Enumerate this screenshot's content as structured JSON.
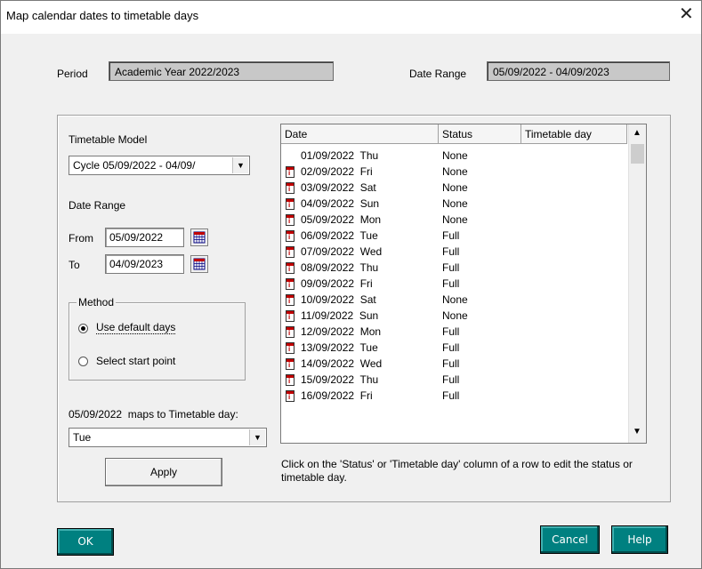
{
  "window": {
    "title": "Map calendar dates to timetable days",
    "close_glyph": "✕"
  },
  "period": {
    "label": "Period",
    "value": "Academic Year 2022/2023"
  },
  "date_range_top": {
    "label": "Date Range",
    "value": "05/09/2022 - 04/09/2023"
  },
  "timetable_model": {
    "label": "Timetable Model",
    "value": "Cycle 05/09/2022 - 04/09/"
  },
  "date_range": {
    "label": "Date Range",
    "from_label": "From",
    "from_value": "05/09/2022",
    "to_label": "To",
    "to_value": "04/09/2023"
  },
  "method": {
    "label": "Method",
    "options": [
      {
        "label": "Use default days",
        "selected": true
      },
      {
        "label": "Select start point",
        "selected": false
      }
    ]
  },
  "maps_to": {
    "label": "05/09/2022  maps to Timetable day:",
    "value": "Tue"
  },
  "apply_label": "Apply",
  "grid": {
    "columns": [
      "Date",
      "Status",
      "Timetable day"
    ],
    "rows": [
      {
        "date": "01/09/2022  Thu",
        "status": "None",
        "icon": false
      },
      {
        "date": "02/09/2022  Fri",
        "status": "None",
        "icon": true
      },
      {
        "date": "03/09/2022  Sat",
        "status": "None",
        "icon": true
      },
      {
        "date": "04/09/2022  Sun",
        "status": "None",
        "icon": true
      },
      {
        "date": "05/09/2022  Mon",
        "status": "None",
        "icon": true
      },
      {
        "date": "06/09/2022  Tue",
        "status": "Full",
        "icon": true
      },
      {
        "date": "07/09/2022  Wed",
        "status": "Full",
        "icon": true
      },
      {
        "date": "08/09/2022  Thu",
        "status": "Full",
        "icon": true
      },
      {
        "date": "09/09/2022  Fri",
        "status": "Full",
        "icon": true
      },
      {
        "date": "10/09/2022  Sat",
        "status": "None",
        "icon": true
      },
      {
        "date": "11/09/2022  Sun",
        "status": "None",
        "icon": true
      },
      {
        "date": "12/09/2022  Mon",
        "status": "Full",
        "icon": true
      },
      {
        "date": "13/09/2022  Tue",
        "status": "Full",
        "icon": true
      },
      {
        "date": "14/09/2022  Wed",
        "status": "Full",
        "icon": true
      },
      {
        "date": "15/09/2022  Thu",
        "status": "Full",
        "icon": true
      },
      {
        "date": "16/09/2022  Fri",
        "status": "Full",
        "icon": true
      }
    ]
  },
  "hint": "Click on the 'Status' or 'Timetable day' column of a row to edit the status or timetable day.",
  "buttons": {
    "ok": "OK",
    "cancel": "Cancel",
    "help": "Help"
  },
  "colors": {
    "teal_button": "#008080",
    "readonly_field": "#c8c8c8",
    "dialog_bg": "#f0f0f0"
  },
  "icons": [
    "calendar-icon",
    "day-record-icon",
    "dropdown-arrow-icon",
    "close-icon"
  ]
}
